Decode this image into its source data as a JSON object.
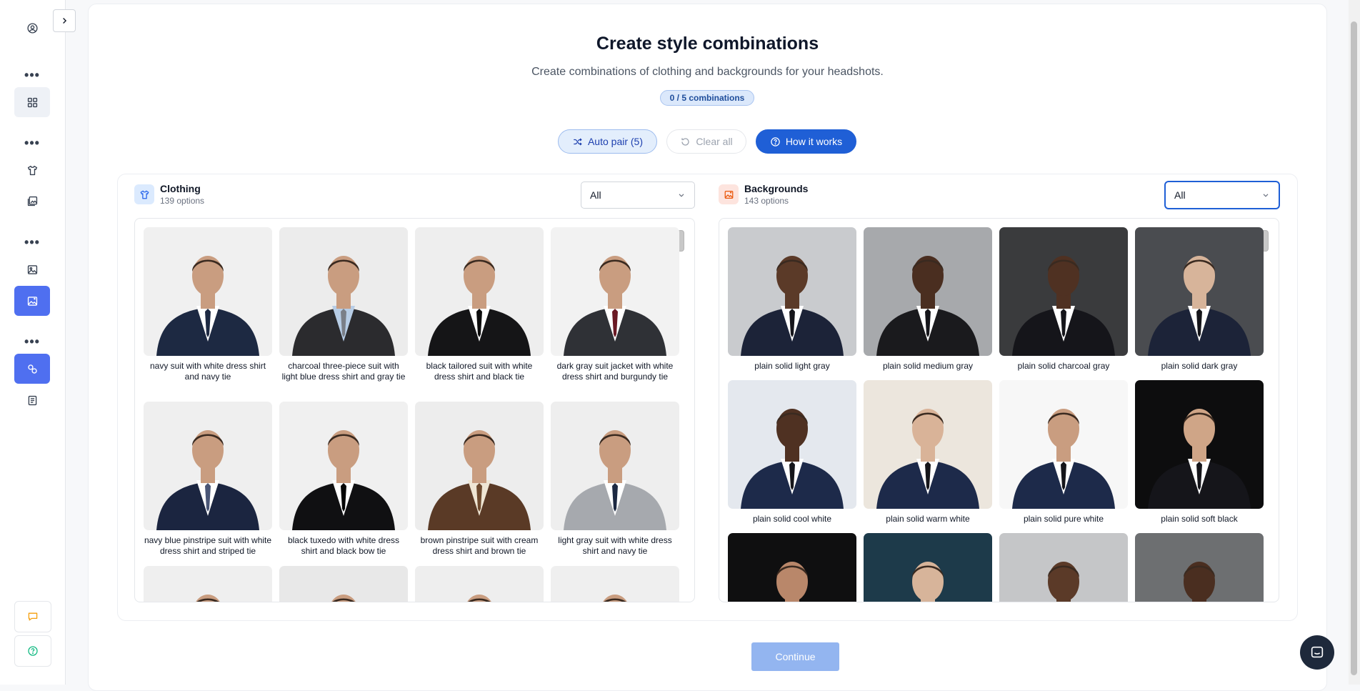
{
  "sidebar": {
    "items": [
      {
        "name": "profile-icon"
      },
      {
        "name": "more-dots-1",
        "label": "•••"
      },
      {
        "name": "grid-icon"
      },
      {
        "name": "more-dots-2",
        "label": "•••"
      },
      {
        "name": "shirt-icon"
      },
      {
        "name": "gallery-icon"
      },
      {
        "name": "more-dots-3",
        "label": "•••"
      },
      {
        "name": "image-icon"
      },
      {
        "name": "backgrounds-icon"
      },
      {
        "name": "more-dots-4",
        "label": "•••"
      },
      {
        "name": "combine-icon"
      },
      {
        "name": "document-icon"
      }
    ],
    "bottom": [
      {
        "name": "chat-icon",
        "color": "#f59e0b"
      },
      {
        "name": "help-icon",
        "color": "#10b981"
      }
    ],
    "active_color": "#4f6ff0"
  },
  "header": {
    "title": "Create style combinations",
    "subtitle": "Create combinations of clothing and backgrounds for your headshots.",
    "badge": "0 / 5 combinations"
  },
  "actions": {
    "auto_pair": "Auto pair (5)",
    "clear_all": "Clear all",
    "how_it_works": "How it works"
  },
  "clothing": {
    "title": "Clothing",
    "count": "139 options",
    "filter": "All",
    "items": [
      {
        "caption": "navy suit with white dress shirt and navy tie",
        "suit": "#1d2942",
        "tie": "#1d2942",
        "shirt": "#ffffff",
        "bg": "#f0f0f0"
      },
      {
        "caption": "charcoal three-piece suit with light blue dress shirt and gray tie",
        "suit": "#2b2b2e",
        "tie": "#7a7f88",
        "shirt": "#b7cde6",
        "bg": "#ececec"
      },
      {
        "caption": "black tailored suit with white dress shirt and black tie",
        "suit": "#151517",
        "tie": "#0c0c0c",
        "shirt": "#ffffff",
        "bg": "#eeeeee"
      },
      {
        "caption": "dark gray suit jacket with white dress shirt and burgundy tie",
        "suit": "#2f3136",
        "tie": "#6b1a24",
        "shirt": "#ffffff",
        "bg": "#f2f2f2"
      },
      {
        "caption": "navy blue pinstripe suit with white dress shirt and striped tie",
        "suit": "#1b2540",
        "tie": "#4a5676",
        "shirt": "#ffffff",
        "bg": "#efefef"
      },
      {
        "caption": "black tuxedo with white dress shirt and black bow tie",
        "suit": "#101012",
        "tie": "#050505",
        "shirt": "#ffffff",
        "bg": "#f0f0f0"
      },
      {
        "caption": "brown pinstripe suit with cream dress shirt and brown tie",
        "suit": "#5a3a26",
        "tie": "#6e4a2e",
        "shirt": "#efe6d4",
        "bg": "#ededed"
      },
      {
        "caption": "light gray suit with white dress shirt and navy tie",
        "suit": "#a6a9ae",
        "tie": "#1d2942",
        "shirt": "#ffffff",
        "bg": "#eeeeee"
      },
      {
        "caption": "",
        "suit": "#2a2a2a",
        "tie": "#222",
        "shirt": "#fff",
        "bg": "#efefef"
      },
      {
        "caption": "",
        "suit": "#2a2a2a",
        "tie": "#222",
        "shirt": "#fff",
        "bg": "#e8e8e8"
      },
      {
        "caption": "",
        "suit": "#2a2a2a",
        "tie": "#222",
        "shirt": "#fff",
        "bg": "#eeeeee"
      },
      {
        "caption": "",
        "suit": "#2a2a2a",
        "tie": "#222",
        "shirt": "#fff",
        "bg": "#efefef"
      }
    ]
  },
  "backgrounds": {
    "title": "Backgrounds",
    "count": "143 options",
    "filter": "All",
    "items": [
      {
        "caption": "plain solid light gray",
        "bg": "#c9cbce",
        "suit": "#1c2338",
        "skin": "#5b3a28"
      },
      {
        "caption": "plain solid medium gray",
        "bg": "#a7a9ac",
        "suit": "#1a1a1d",
        "skin": "#4a2e20"
      },
      {
        "caption": "plain solid charcoal gray",
        "bg": "#3a3b3d",
        "suit": "#15151a",
        "skin": "#4f3122"
      },
      {
        "caption": "plain solid dark gray",
        "bg": "#4a4c50",
        "suit": "#1c2338",
        "skin": "#d7b49a"
      },
      {
        "caption": "plain solid cool white",
        "bg": "#e4e8ee",
        "suit": "#1d2a4a",
        "skin": "#4f3122"
      },
      {
        "caption": "plain solid warm white",
        "bg": "#ece6dd",
        "suit": "#1d2a4a",
        "skin": "#d9b398"
      },
      {
        "caption": "plain solid pure white",
        "bg": "#f7f7f7",
        "suit": "#1d2a4a",
        "skin": "#c99d80"
      },
      {
        "caption": "plain solid soft black",
        "bg": "#0d0d0e",
        "suit": "#15151a",
        "skin": "#cfa587"
      },
      {
        "caption": "",
        "bg": "#0f0f10",
        "suit": "#111",
        "skin": "#b9876a"
      },
      {
        "caption": "",
        "bg": "#1d3a4a",
        "suit": "#1d2a4a",
        "skin": "#d7b49a"
      },
      {
        "caption": "",
        "bg": "#c5c6c8",
        "suit": "#1a1a1d",
        "skin": "#5b3a28"
      },
      {
        "caption": "",
        "bg": "#6d6f71",
        "suit": "#1c2338",
        "skin": "#4a2e20"
      }
    ]
  },
  "footer": {
    "continue": "Continue"
  }
}
